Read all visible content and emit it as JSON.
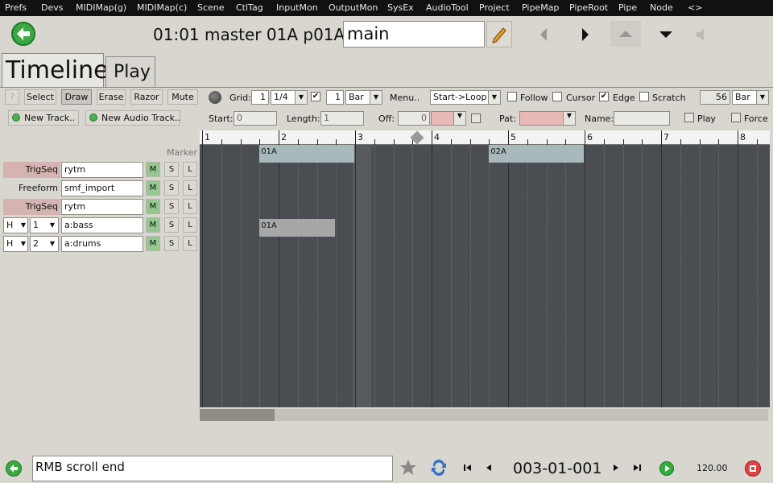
{
  "menu": [
    "Prefs",
    "Devs",
    "MIDIMap(g)",
    "MIDIMap(c)",
    "Scene",
    "CtlTag",
    "InputMon",
    "OutputMon",
    "SysEx",
    "AudioTool",
    "Project",
    "PipeMap",
    "PipeRoot",
    "Pipe",
    "Node",
    "<>"
  ],
  "header": {
    "position_label": "01:01 master  01A  p01A :",
    "name_value": "main"
  },
  "tabs": {
    "timeline": "Timeline",
    "play": "Play"
  },
  "toolbar": {
    "help": "?",
    "select": "Select",
    "draw": "Draw",
    "erase": "Erase",
    "razor": "Razor",
    "mute": "Mute",
    "grid_label": "Grid:",
    "grid_num": "1",
    "grid_div": "1/4",
    "grid_check": "✔",
    "len_num": "1",
    "len_unit": "Bar",
    "menu": "Menu..",
    "mode": "Start->Loop",
    "follow": "Follow",
    "cursor": "Cursor",
    "edge": "Edge",
    "edge_check": "✔",
    "scratch": "Scratch",
    "bars_num": "56",
    "bars_unit": "Bar"
  },
  "toolbar2": {
    "new_track": "New Track..",
    "new_audio_track": "New Audio Track..",
    "start_label": "Start:",
    "start_value": "0",
    "length_label": "Length:",
    "length_value": "1",
    "off_label": "Off:",
    "off_value": "0",
    "pat_label": "Pat:",
    "name_label": "Name:",
    "play": "Play",
    "force": "Force"
  },
  "marker_label": "Marker",
  "tracks": [
    {
      "type": "TrigSeq",
      "name": "rytm",
      "m": "M",
      "s": "S",
      "l": "L"
    },
    {
      "type": "Freeform",
      "name": "smf_import",
      "m": "M",
      "s": "S",
      "l": "L"
    },
    {
      "type": "TrigSeq",
      "name": "rytm",
      "m": "M",
      "s": "S",
      "l": "L"
    },
    {
      "h": "H",
      "ch": "1",
      "name": "a:bass",
      "m": "M",
      "s": "S",
      "l": "L"
    },
    {
      "h": "H",
      "ch": "2",
      "name": "a:drums",
      "m": "M",
      "s": "S",
      "l": "L"
    }
  ],
  "ruler": [
    "1",
    "2",
    "3",
    "4",
    "5",
    "6",
    "7",
    "8"
  ],
  "ruler_marker": "R",
  "clips": [
    {
      "label": "01A",
      "track": 1,
      "start_bar": 1.75,
      "length_bars": 1.25
    },
    {
      "label": "02A",
      "track": 1,
      "start_bar": 4.75,
      "length_bars": 1.25
    },
    {
      "label": "01A",
      "track": 5,
      "start_bar": 1.75,
      "length_bars": 1.0
    }
  ],
  "status": {
    "message": "RMB scroll end",
    "position": "003-01-001",
    "tempo": "120.00"
  },
  "colors": {
    "grid_bg": "#4a4e53",
    "clip": "#a9b8bb",
    "clip_dim": "#a7a7a7",
    "mute_green": "#94c88f",
    "trigseq": "#d4b3b0",
    "record_red": "#e04040"
  }
}
